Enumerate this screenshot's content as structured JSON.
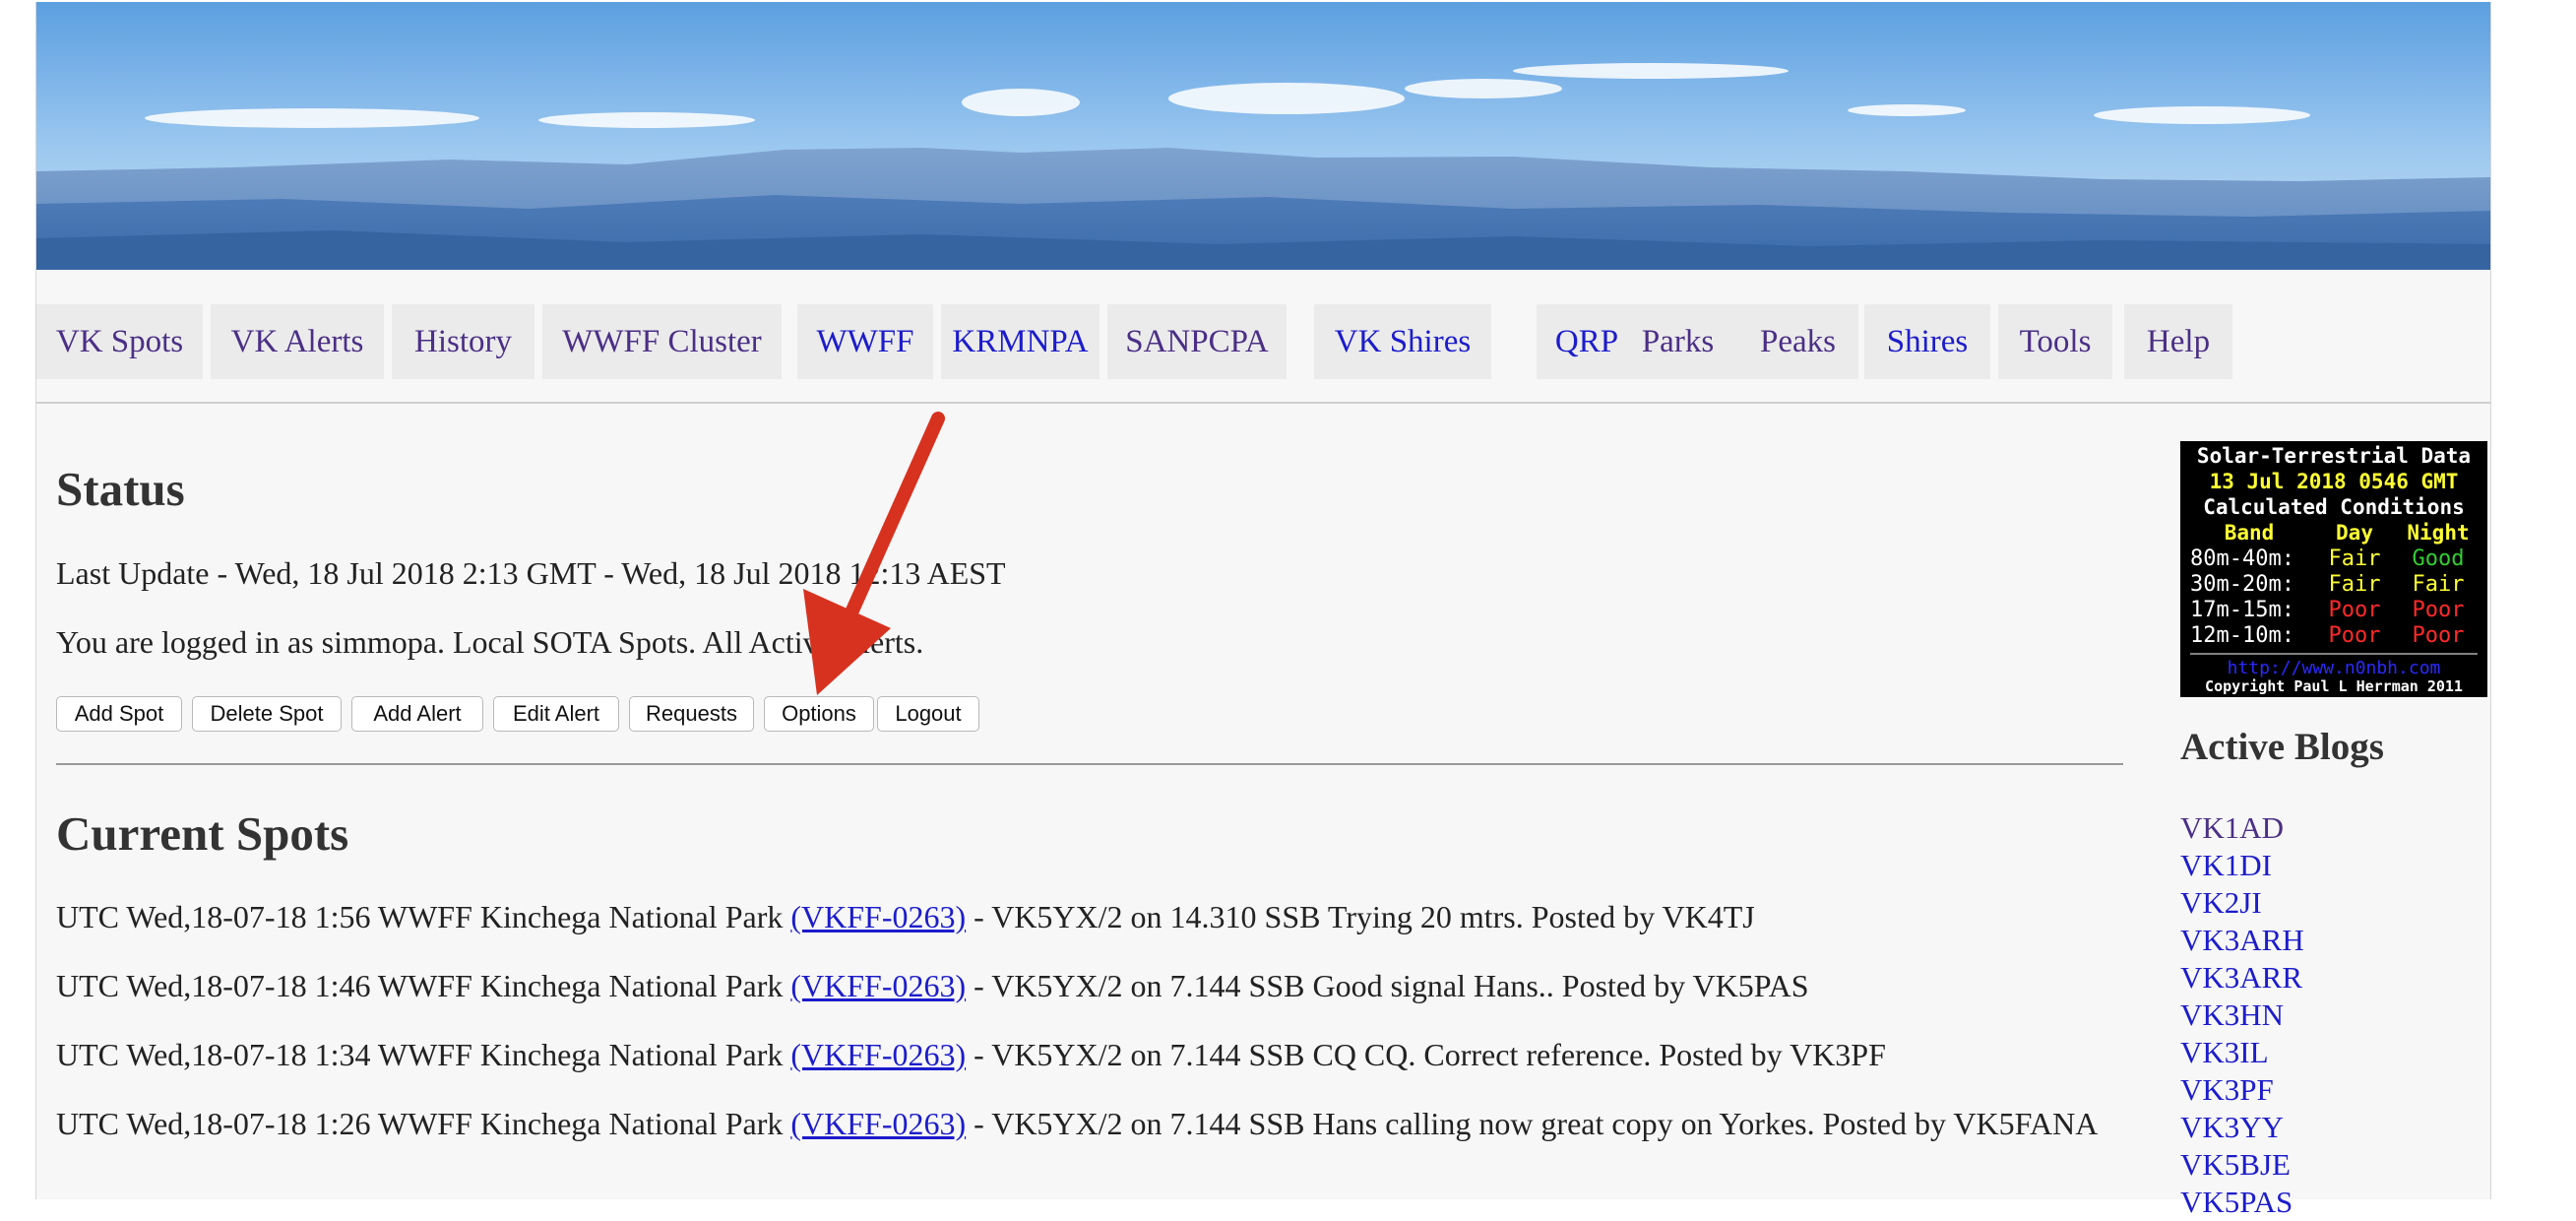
{
  "nav": {
    "items": [
      {
        "label": "VK Spots",
        "visited": true
      },
      {
        "label": "VK Alerts",
        "visited": true
      },
      {
        "label": "History",
        "visited": true
      },
      {
        "label": "WWFF Cluster",
        "visited": true
      },
      {
        "label": "WWFF",
        "visited": false
      },
      {
        "label": "KRMNPA",
        "visited": false
      },
      {
        "label": "SANPCPA",
        "visited": true
      },
      {
        "label": "VK Shires",
        "visited": false
      },
      {
        "label": "QRP",
        "visited": false
      },
      {
        "label": "Parks",
        "visited": true
      },
      {
        "label": "Peaks",
        "visited": true
      },
      {
        "label": "Shires",
        "visited": false
      },
      {
        "label": "Tools",
        "visited": true
      },
      {
        "label": "Help",
        "visited": true
      }
    ]
  },
  "status": {
    "title": "Status",
    "last_update": "Last Update - Wed, 18 Jul 2018 2:13 GMT - Wed, 18 Jul 2018 12:13 AEST",
    "login": "You are logged in as simmopa. Local SOTA Spots. All Active Alerts."
  },
  "buttons": {
    "add_spot": "Add Spot",
    "delete_spot": "Delete Spot",
    "add_alert": "Add Alert",
    "edit_alert": "Edit Alert",
    "requests": "Requests",
    "options": "Options",
    "logout": "Logout"
  },
  "spots": {
    "title": "Current Spots",
    "items": [
      {
        "prefix": "UTC Wed,18-07-18 1:56 WWFF Kinchega National Park ",
        "ref": "(VKFF-0263)",
        "suffix": " - VK5YX/2 on 14.310 SSB Trying 20 mtrs. Posted by VK4TJ"
      },
      {
        "prefix": "UTC Wed,18-07-18 1:46 WWFF Kinchega National Park ",
        "ref": "(VKFF-0263)",
        "suffix": " - VK5YX/2 on 7.144 SSB Good signal Hans.. Posted by VK5PAS"
      },
      {
        "prefix": "UTC Wed,18-07-18 1:34 WWFF Kinchega National Park ",
        "ref": "(VKFF-0263)",
        "suffix": " - VK5YX/2 on 7.144 SSB CQ CQ. Correct reference. Posted by VK3PF"
      },
      {
        "prefix": "UTC Wed,18-07-18 1:26 WWFF Kinchega National Park ",
        "ref": "(VKFF-0263)",
        "suffix": " - VK5YX/2 on 7.144 SSB Hans calling now great copy on Yorkes. Posted by VK5FANA"
      }
    ]
  },
  "solar": {
    "title": "Solar-Terrestrial Data",
    "date": "13 Jul 2018 0546 GMT",
    "subtitle": "Calculated Conditions",
    "col_band": "Band",
    "col_day": "Day",
    "col_night": "Night",
    "rows": [
      {
        "band": "80m-40m:",
        "day": "Fair",
        "night": "Good"
      },
      {
        "band": "30m-20m:",
        "day": "Fair",
        "night": "Fair"
      },
      {
        "band": "17m-15m:",
        "day": "Poor",
        "night": "Poor"
      },
      {
        "band": "12m-10m:",
        "day": "Poor",
        "night": "Poor"
      }
    ],
    "url": "http://www.n0nbh.com",
    "copyright": "Copyright Paul L Herrman 2011",
    "colors": {
      "Good": "#33cc33",
      "Fair": "#ffff33",
      "Poor": "#ff2a2a"
    }
  },
  "blogs": {
    "title": "Active Blogs",
    "items": [
      {
        "label": "VK1AD",
        "visited": true
      },
      {
        "label": "VK1DI",
        "visited": false
      },
      {
        "label": "VK2JI",
        "visited": false
      },
      {
        "label": "VK3ARH",
        "visited": false
      },
      {
        "label": "VK3ARR",
        "visited": false
      },
      {
        "label": "VK3HN",
        "visited": false
      },
      {
        "label": "VK3IL",
        "visited": false
      },
      {
        "label": "VK3PF",
        "visited": false
      },
      {
        "label": "VK3YY",
        "visited": false
      },
      {
        "label": "VK5BJE",
        "visited": false
      },
      {
        "label": "VK5PAS",
        "visited": false
      }
    ]
  }
}
